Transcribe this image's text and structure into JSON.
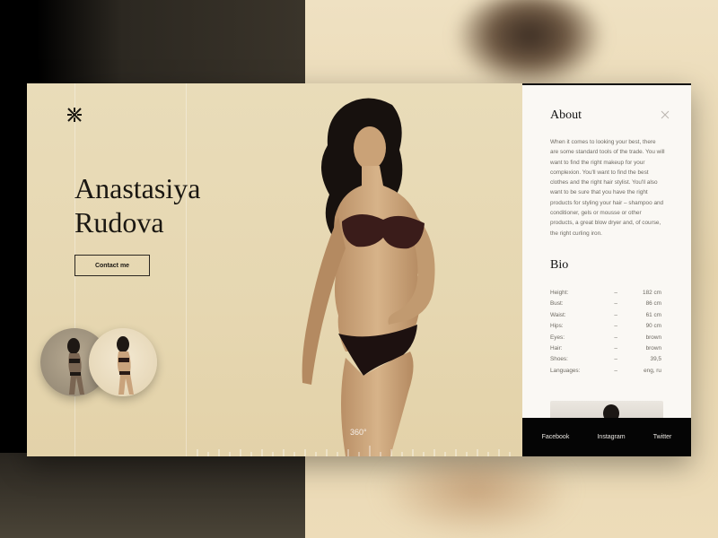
{
  "hero": {
    "first_name": "Anastasiya",
    "last_name": "Rudova",
    "contact_label": "Contact me",
    "rotation_label": "360°"
  },
  "about": {
    "title": "About",
    "text": "When it comes to looking your best, there are some standard tools of the trade. You will want to find the right makeup for your complexion. You'll want to find the best clothes and the right hair stylist. You'll also want to be sure that you have the right products for styling your hair – shampoo and conditioner, gels or mousse or other products, a great blow dryer and, of course, the right curling iron."
  },
  "bio": {
    "title": "Bio",
    "rows": [
      {
        "label": "Height:",
        "dash": "–",
        "value": "182 cm"
      },
      {
        "label": "Bust:",
        "dash": "–",
        "value": "86 cm"
      },
      {
        "label": "Waist:",
        "dash": "–",
        "value": "61 cm"
      },
      {
        "label": "Hips:",
        "dash": "–",
        "value": "90 cm"
      },
      {
        "label": "Eyes:",
        "dash": "–",
        "value": "brown"
      },
      {
        "label": "Hair:",
        "dash": "–",
        "value": "brown"
      },
      {
        "label": "Shoes:",
        "dash": "–",
        "value": "39,5"
      },
      {
        "label": "Languages:",
        "dash": "–",
        "value": "eng, ru"
      }
    ]
  },
  "social": {
    "facebook": "Facebook",
    "instagram": "Instagram",
    "twitter": "Twitter"
  },
  "icons": {
    "logo": "logo-icon",
    "close": "close-icon"
  },
  "colors": {
    "hero_bg": "#e8dab5",
    "panel_bg": "#faf8f4",
    "footer_bg": "#050505",
    "text_dark": "#1a1712"
  }
}
